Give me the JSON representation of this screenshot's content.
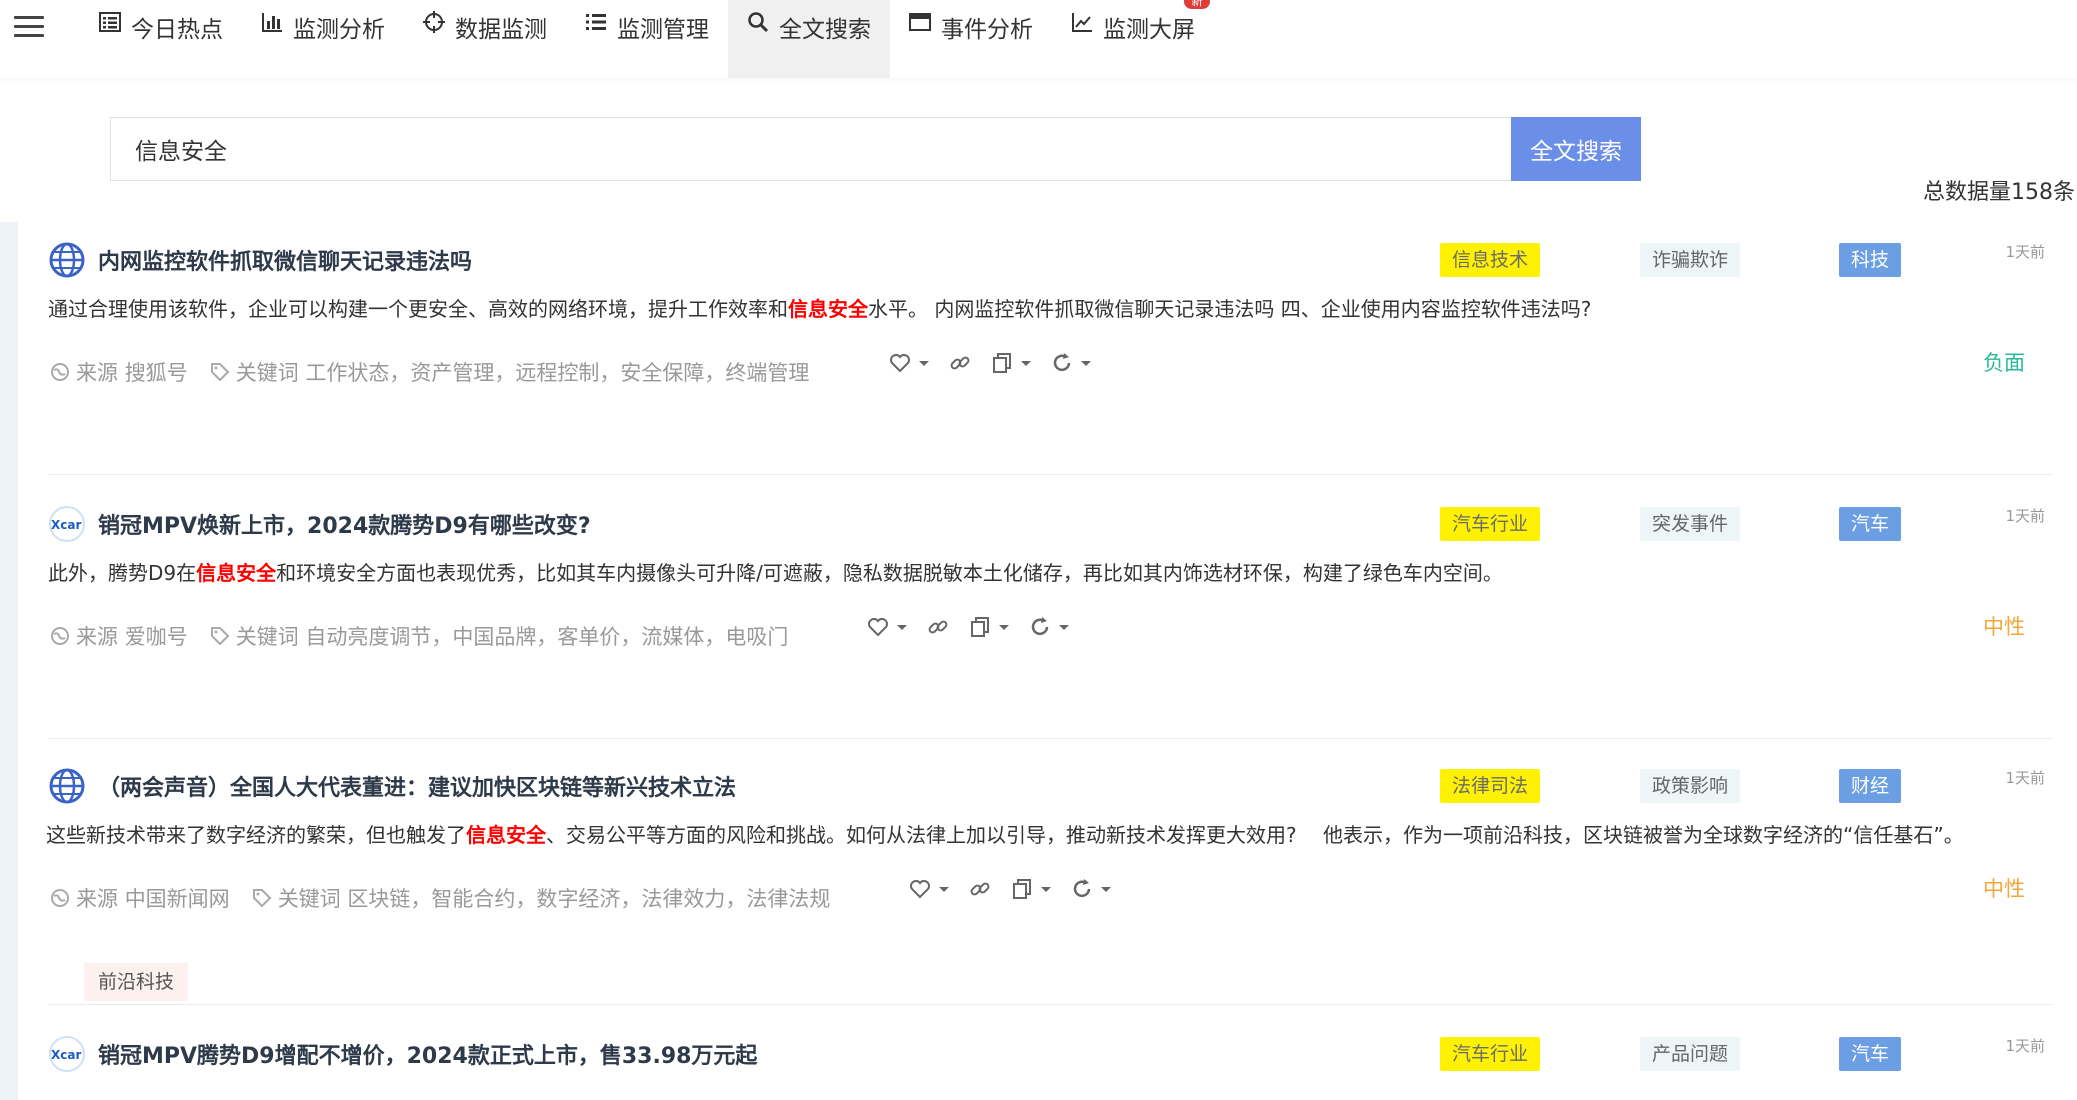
{
  "nav": {
    "items": [
      {
        "label": "今日热点",
        "icon": "list-icon"
      },
      {
        "label": "监测分析",
        "icon": "bar-chart-icon"
      },
      {
        "label": "数据监测",
        "icon": "crosshair-icon"
      },
      {
        "label": "监测管理",
        "icon": "list-bullets-icon"
      },
      {
        "label": "全文搜索",
        "icon": "search-icon"
      },
      {
        "label": "事件分析",
        "icon": "card-icon"
      },
      {
        "label": "监测大屏",
        "icon": "line-chart-icon"
      }
    ],
    "active": "全文搜索",
    "new_badge": "新"
  },
  "search": {
    "value": "信息安全",
    "button_label": "全文搜索"
  },
  "total_text": "总数据量158条",
  "meta_labels": {
    "source": "来源",
    "keywords": "关键词"
  },
  "results": [
    {
      "title": "内网监控软件抓取微信聊天记录违法吗",
      "logo": "globe-icon",
      "tags": [
        "信息技术",
        "诈骗欺诈",
        "科技"
      ],
      "time": "1天前",
      "body_before": "通过合理使用该软件，企业可以构建一个更安全、高效的网络环境，提升工作效率和",
      "highlight": "信息安全",
      "body_after": "水平。 内网监控软件抓取微信聊天记录违法吗 四、企业使用内容监控软件违法吗?",
      "source": "搜狐号",
      "keywords": "工作状态，资产管理，远程控制，安全保障，终端管理",
      "sentiment": "负面"
    },
    {
      "title": "销冠MPV焕新上市，2024款腾势D9有哪些改变?",
      "logo": "xcar-logo-icon",
      "tags": [
        "汽车行业",
        "突发事件",
        "汽车"
      ],
      "time": "1天前",
      "body_before": "此外，腾势D9在",
      "highlight": "信息安全",
      "body_after": "和环境安全方面也表现优秀，比如其车内摄像头可升降/可遮蔽，隐私数据脱敏本土化储存，再比如其内饰选材环保，构建了绿色车内空间。",
      "source": "爱咖号",
      "keywords": "自动亮度调节，中国品牌，客单价，流媒体，电吸门",
      "sentiment": "中性"
    },
    {
      "title": "（两会声音）全国人大代表董进：建议加快区块链等新兴技术立法",
      "logo": "globe-icon",
      "tags": [
        "法律司法",
        "政策影响",
        "财经"
      ],
      "time": "1天前",
      "body_before": "这些新技术带来了数字经济的繁荣，但也触发了",
      "highlight": "信息安全",
      "body_after": "、交易公平等方面的风险和挑战。如何从法律上加以引导，推动新技术发挥更大效用?　 他表示，作为一项前沿科技，区块链被誉为全球数字经济的“信任基石”。",
      "source": "中国新闻网",
      "keywords": "区块链，智能合约，数字经济，法律效力，法律法规",
      "sentiment": "中性",
      "extra_tag": "前沿科技"
    },
    {
      "title": "销冠MPV腾势D9增配不增价，2024款正式上市，售33.98万元起",
      "logo": "xcar-logo-icon",
      "tags": [
        "汽车行业",
        "产品问题",
        "汽车"
      ],
      "time": "1天前"
    }
  ],
  "colors": {
    "accent": "#6b8ee8",
    "highlight": "#ff0000",
    "negative": "#2cb89a",
    "neutral": "#f3a73a",
    "tag_yellow": "#fff200",
    "tag_blue": "#6c9ee4"
  }
}
